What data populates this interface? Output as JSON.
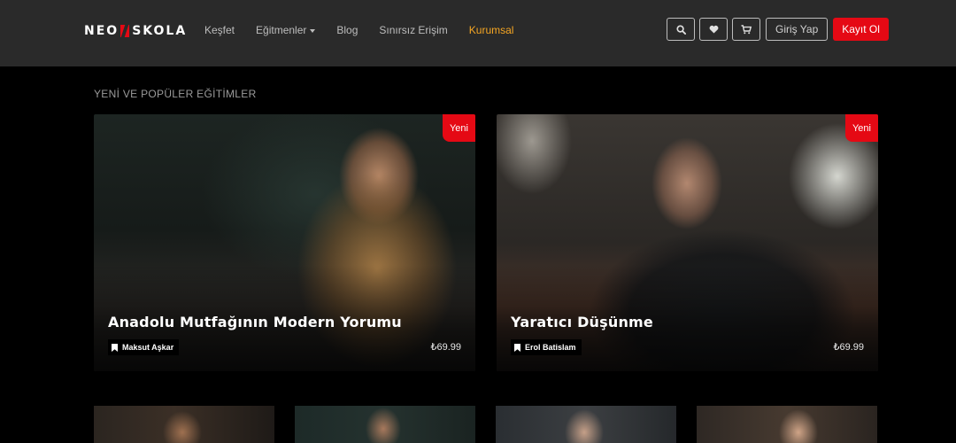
{
  "brand": {
    "logo_left": "NEO",
    "logo_right": "SKOLA",
    "accent_color": "#e50914"
  },
  "nav": {
    "links": [
      {
        "label": "Keşfet",
        "has_dropdown": false,
        "active": false
      },
      {
        "label": "Eğitmenler",
        "has_dropdown": true,
        "active": false
      },
      {
        "label": "Blog",
        "has_dropdown": false,
        "active": false
      },
      {
        "label": "Sınırsız Erişim",
        "has_dropdown": false,
        "active": false
      },
      {
        "label": "Kurumsal",
        "has_dropdown": false,
        "active": true
      }
    ],
    "active_color": "#f5a623",
    "icons": [
      "search-icon",
      "heart-icon",
      "cart-icon"
    ],
    "login_label": "Giriş Yap",
    "signup_label": "Kayıt Ol"
  },
  "section": {
    "title": "YENİ VE POPÜLER EĞİTİMLER"
  },
  "featured": [
    {
      "badge": "Yeni",
      "title": "Anadolu Mutfağının Modern Yorumu",
      "instructor": "Maksut Aşkar",
      "price": "₺69.99"
    },
    {
      "badge": "Yeni",
      "title": "Yaratıcı Düşünme",
      "instructor": "Erol Batislam",
      "price": "₺69.99"
    }
  ]
}
